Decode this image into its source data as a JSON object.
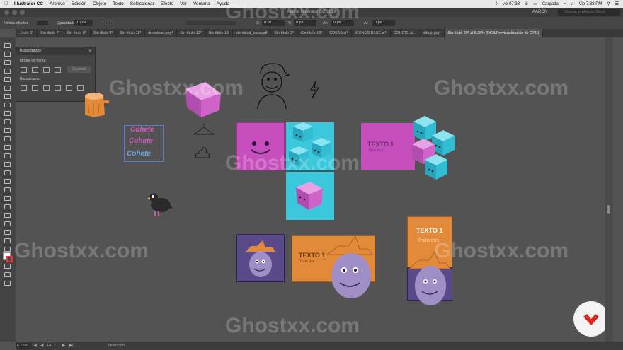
{
  "menubar": {
    "app": "Illustrator CC",
    "items": [
      "Archivo",
      "Edición",
      "Objeto",
      "Texto",
      "Seleccionar",
      "Efecto",
      "Ver",
      "Ventana",
      "Ayuda"
    ],
    "time_left": "vie 07:38",
    "battery": "Cargada",
    "clock": "Vie 7:38 PM"
  },
  "titlebar": {
    "title": "Adobe Illustrator CC 2019",
    "user": "AARÓN",
    "search_placeholder": "Buscar en Adobe Stock"
  },
  "control": {
    "selection": "Varios objetos",
    "opacity_label": "Opacidad:",
    "opacity": "100%",
    "x_label": "X:",
    "x": "0 px",
    "y_label": "Y:",
    "y": "0 px",
    "w_label": "An:",
    "w": "0 px",
    "h_label": "Al:",
    "h": "0 px"
  },
  "tabs": [
    "...ítulo-5*",
    "Sin título-7*",
    "Sin título-8*",
    "Sin título-9*",
    "Sin título-11*",
    "download.png*",
    "Sin título-12*",
    "Sin título-13",
    "identidad_casa.pdf",
    "Sin título-2*",
    "Sin título-18*",
    "COSAS.ai*",
    "ICONOS BASE.ai*",
    "COHETE.ai...",
    "dibujo.jpg*",
    "Sin título-20* al 6.25% (RGB/Previsualización de GPU)"
  ],
  "panel": {
    "title": "Buscatrazos",
    "modos_label": "Modos de forma:",
    "expand_label": "Expandir",
    "buscatrazos_label": "Buscatrazos:"
  },
  "art": {
    "texto_title": "TEXTO 1",
    "texto_sub": "Texto dos",
    "cohete": [
      "Cohete",
      "Cohete",
      "Cohete"
    ]
  },
  "watermark": "Ghostxx.com",
  "status": {
    "zoom": "6.25%",
    "page": "14",
    "page_total": "7",
    "tool": "Selección"
  },
  "colors": {
    "magenta": "#c64fbd",
    "cyan": "#35c6dc",
    "orange": "#e08a3a",
    "purple": "#5a4a8a",
    "face": "#9f8fc6"
  }
}
